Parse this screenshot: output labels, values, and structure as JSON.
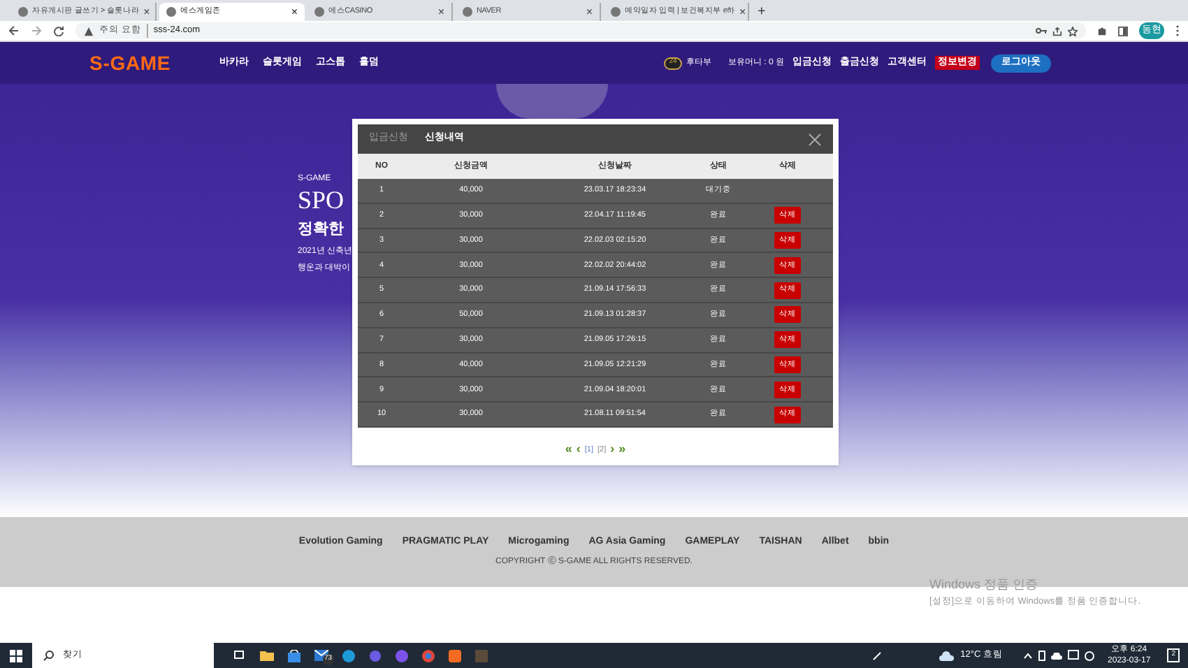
{
  "browser": {
    "tabs": [
      {
        "title": "자유게시판 글쓰기 > 슬롯나라",
        "selected": false,
        "close": "×"
      },
      {
        "title": "에스게임존",
        "selected": true,
        "close": "×"
      },
      {
        "title": "에스CASINO",
        "selected": false,
        "close": "×"
      },
      {
        "title": "NAVER",
        "selected": false,
        "close": "×"
      },
      {
        "title": "예약일자 입력 | 보건복지부 e하",
        "selected": false,
        "close": "×"
      }
    ],
    "new_tab": "+",
    "security": "주의 요함",
    "url": "sss-24.com",
    "profile": "동현"
  },
  "site": {
    "logo": "S-GAME",
    "nav": [
      "바카라",
      "슬롯게임",
      "고스톱",
      "홀덤"
    ],
    "user": {
      "badge": "24",
      "level": "후타부",
      "money": "보유머니 : 0 원"
    },
    "links": [
      {
        "label": "입금신청",
        "kind": "plain"
      },
      {
        "label": "출금신청",
        "kind": "plain"
      },
      {
        "label": "고객센터",
        "kind": "plain"
      },
      {
        "label": "정보변경",
        "kind": "highlight"
      }
    ],
    "logout": "로그아웃"
  },
  "hero": {
    "brand": "S-GAME",
    "title": "SPO",
    "headline": "정확한",
    "lines": [
      "2021년 신축년",
      "행운과 대박이"
    ]
  },
  "modal": {
    "tabs": [
      {
        "label": "입금신청",
        "selected": false
      },
      {
        "label": "신청내역",
        "selected": true
      }
    ],
    "columns": [
      "NO",
      "신청금액",
      "신청날짜",
      "상태",
      "삭제"
    ],
    "rows": [
      {
        "no": "1",
        "amount": "40,000",
        "date": "23.03.17 18:23:34",
        "status": "대기중"
      },
      {
        "no": "2",
        "amount": "30,000",
        "date": "22.04.17 11:19:45",
        "status": "완료",
        "delete": "삭제"
      },
      {
        "no": "3",
        "amount": "30,000",
        "date": "22.02.03 02:15:20",
        "status": "완료",
        "delete": "삭제"
      },
      {
        "no": "4",
        "amount": "30,000",
        "date": "22.02.02 20:44:02",
        "status": "완료",
        "delete": "삭제"
      },
      {
        "no": "5",
        "amount": "30,000",
        "date": "21.09.14 17:56:33",
        "status": "완료",
        "delete": "삭제"
      },
      {
        "no": "6",
        "amount": "50,000",
        "date": "21.09.13 01:28:37",
        "status": "완료",
        "delete": "삭제"
      },
      {
        "no": "7",
        "amount": "30,000",
        "date": "21.09.05 17:26:15",
        "status": "완료",
        "delete": "삭제"
      },
      {
        "no": "8",
        "amount": "40,000",
        "date": "21.09.05 12:21:29",
        "status": "완료",
        "delete": "삭제"
      },
      {
        "no": "9",
        "amount": "30,000",
        "date": "21.09.04 18:20:01",
        "status": "완료",
        "delete": "삭제"
      },
      {
        "no": "10",
        "amount": "30,000",
        "date": "21.08.11 09:51:54",
        "status": "완료",
        "delete": "삭제"
      }
    ],
    "pagination": {
      "first": "«",
      "prev": "‹",
      "pages": [
        {
          "label": "[1]",
          "selected": true
        },
        {
          "label": "[2]",
          "selected": false
        }
      ],
      "next": "›",
      "last": "»"
    }
  },
  "footer": {
    "providers": [
      "Evolution Gaming",
      "PRAGMATIC PLAY",
      "Microgaming",
      "AG Asia Gaming",
      "GAMEPLAY",
      "TAISHAN",
      "Allbet",
      "bbin"
    ],
    "copyright": "COPYRIGHT ⓒ S-GAME ALL RIGHTS RESERVED."
  },
  "activation": {
    "title": "Windows 정품 인증",
    "text": "[설정]으로 이동하여 Windows를 정품 인증합니다."
  },
  "taskbar": {
    "search": "찾기",
    "mail_badge": "73",
    "weather": "12°C 흐림",
    "time": "오후 6:24",
    "date": "2023-03-17",
    "notifications": "2"
  }
}
